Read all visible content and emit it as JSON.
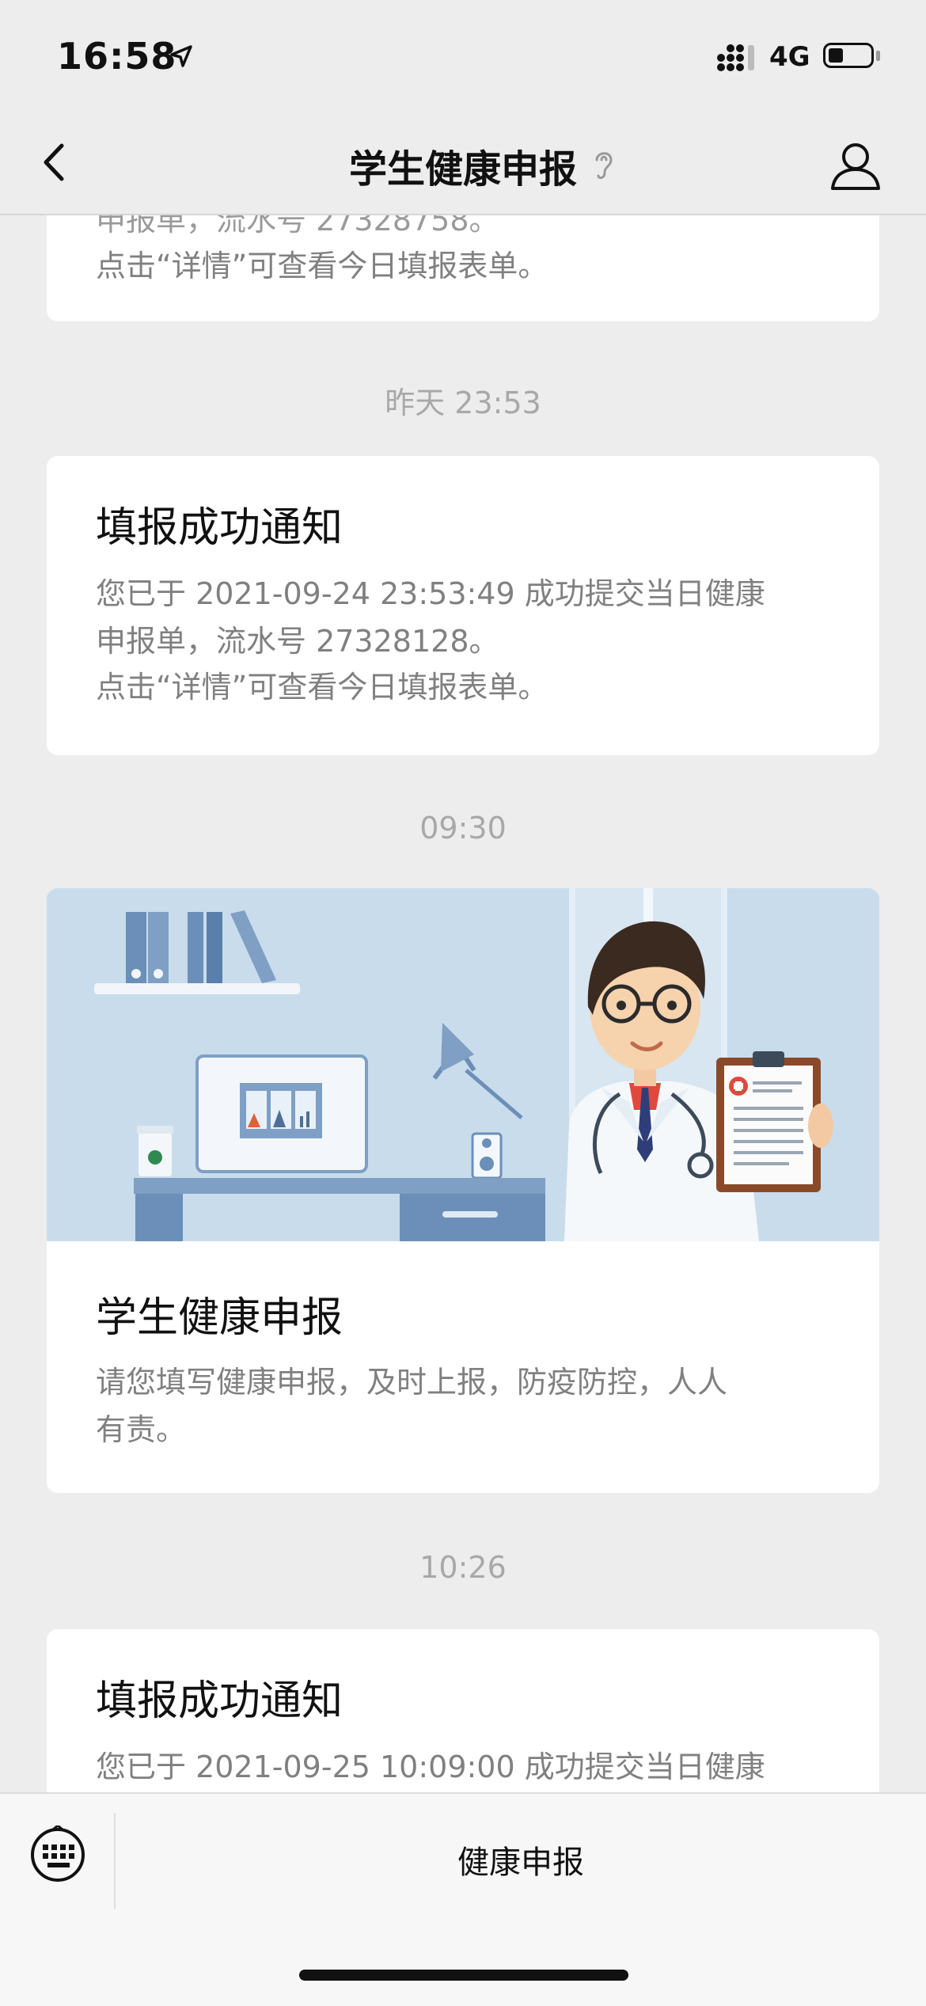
{
  "status": {
    "time": "16:58",
    "network": "4G"
  },
  "nav": {
    "title": "学生健康申报"
  },
  "feed": {
    "card0": {
      "partial_line": "申报单，流水号 27328758。",
      "line": "点击“详情”可查看今日填报表单。"
    },
    "ts1": "昨天 23:53",
    "card1": {
      "title": "填报成功通知",
      "line1": "您已于 2021-09-24 23:53:49 成功提交当日健康",
      "line2": "申报单，流水号 27328128。",
      "line3": "点击“详情”可查看今日填报表单。"
    },
    "ts2": "09:30",
    "card2": {
      "title": "学生健康申报",
      "line1": "请您填写健康申报，及时上报，防疫防控，人人",
      "line2": "有责。"
    },
    "ts3": "10:26",
    "card3": {
      "title": "填报成功通知",
      "line1": "您已于 2021-09-25 10:09:00 成功提交当日健康"
    }
  },
  "bottom": {
    "menu_label": "健康申报"
  }
}
